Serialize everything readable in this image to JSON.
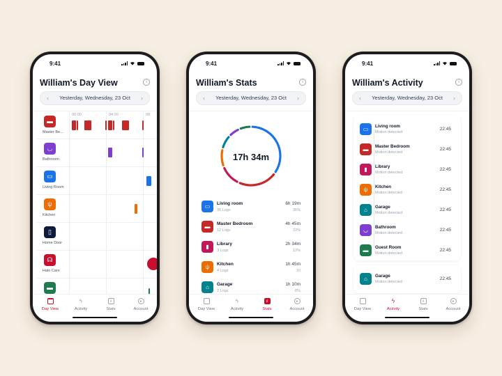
{
  "colors": {
    "accent": "#c8102e",
    "living_room": "#1a73e8",
    "master_bedroom": "#c62828",
    "library": "#c2185b",
    "kitchen": "#ef6c00",
    "garage": "#00838f",
    "bathroom": "#7e3fd1",
    "guest_room": "#1e7a4f",
    "home_door": "#0f1b3d",
    "halo_care": "#c8102e"
  },
  "status_bar": {
    "time": "9:41"
  },
  "date_nav": {
    "label": "Yesterday, Wednesday, 23 Oct",
    "prev_icon": "chevron-left-icon",
    "next_icon": "chevron-right-icon"
  },
  "tabs": [
    {
      "label": "Day View",
      "icon": "calendar-icon"
    },
    {
      "label": "Activity",
      "icon": "lightning-icon"
    },
    {
      "label": "Stats",
      "icon": "stats-icon"
    },
    {
      "label": "Account",
      "icon": "account-icon"
    }
  ],
  "day_view": {
    "title": "William's Day View",
    "active_tab": "Day View",
    "time_ticks": [
      "00:00",
      "04:00",
      "08:"
    ],
    "rooms": [
      {
        "label": "Master Be...",
        "icon": "bed-icon",
        "color": "#c62828"
      },
      {
        "label": "Bathroom",
        "icon": "bathtub-icon",
        "color": "#7e3fd1"
      },
      {
        "label": "Living Room",
        "icon": "sofa-icon",
        "color": "#1a73e8"
      },
      {
        "label": "Kitchen",
        "icon": "utensils-icon",
        "color": "#ef6c00"
      },
      {
        "label": "Home Door",
        "icon": "door-icon",
        "color": "#0f1b3d"
      },
      {
        "label": "Halo Care",
        "icon": "headset-icon",
        "color": "#c8102e"
      },
      {
        "label": "",
        "icon": "bed-icon",
        "color": "#1e7a4f"
      }
    ]
  },
  "stats": {
    "title": "William's Stats",
    "active_tab": "Stats",
    "total": "17h 34m",
    "items": [
      {
        "name": "Living room",
        "logs": "35 Logs",
        "duration": "6h 19m",
        "percent": "35%",
        "color": "#1a73e8",
        "icon": "sofa-icon"
      },
      {
        "name": "Master Bedroom",
        "logs": "12 Logs",
        "duration": "4h 45m",
        "percent": "22%",
        "color": "#c62828",
        "icon": "bed-icon"
      },
      {
        "name": "Library",
        "logs": "3 Logs",
        "duration": "2h 34m",
        "percent": "12%",
        "color": "#c2185b",
        "icon": "bookmark-icon"
      },
      {
        "name": "Kitchen",
        "logs": "4 Logs",
        "duration": "1h 45m",
        "percent": "10",
        "color": "#ef6c00",
        "icon": "utensils-icon"
      },
      {
        "name": "Garage",
        "logs": "2 Logs",
        "duration": "1h 10m",
        "percent": "8%",
        "color": "#00838f",
        "icon": "garage-icon"
      }
    ]
  },
  "activity": {
    "title": "William's Activity",
    "active_tab": "Activity",
    "items": [
      {
        "name": "Living room",
        "sub": "Motion detected",
        "time": "22:45",
        "color": "#1a73e8",
        "icon": "sofa-icon"
      },
      {
        "name": "Master Bedroom",
        "sub": "Motion detected",
        "time": "22:45",
        "color": "#c62828",
        "icon": "bed-icon"
      },
      {
        "name": "Library",
        "sub": "Motion detected",
        "time": "22:45",
        "color": "#c2185b",
        "icon": "bookmark-icon"
      },
      {
        "name": "Kitchen",
        "sub": "Motion detected",
        "time": "22:45",
        "color": "#ef6c00",
        "icon": "utensils-icon"
      },
      {
        "name": "Garage",
        "sub": "Motion detected",
        "time": "22:45",
        "color": "#00838f",
        "icon": "garage-icon"
      },
      {
        "name": "Bathroom",
        "sub": "Motion detected",
        "time": "22:45",
        "color": "#7e3fd1",
        "icon": "bathtub-icon"
      },
      {
        "name": "Guest Room",
        "sub": "Motion detected",
        "time": "22:45",
        "color": "#1e7a4f",
        "icon": "bed-icon"
      }
    ],
    "extra_item": {
      "name": "Garage",
      "sub": "Motion detected",
      "time": "22:45",
      "color": "#00838f",
      "icon": "garage-icon"
    }
  }
}
